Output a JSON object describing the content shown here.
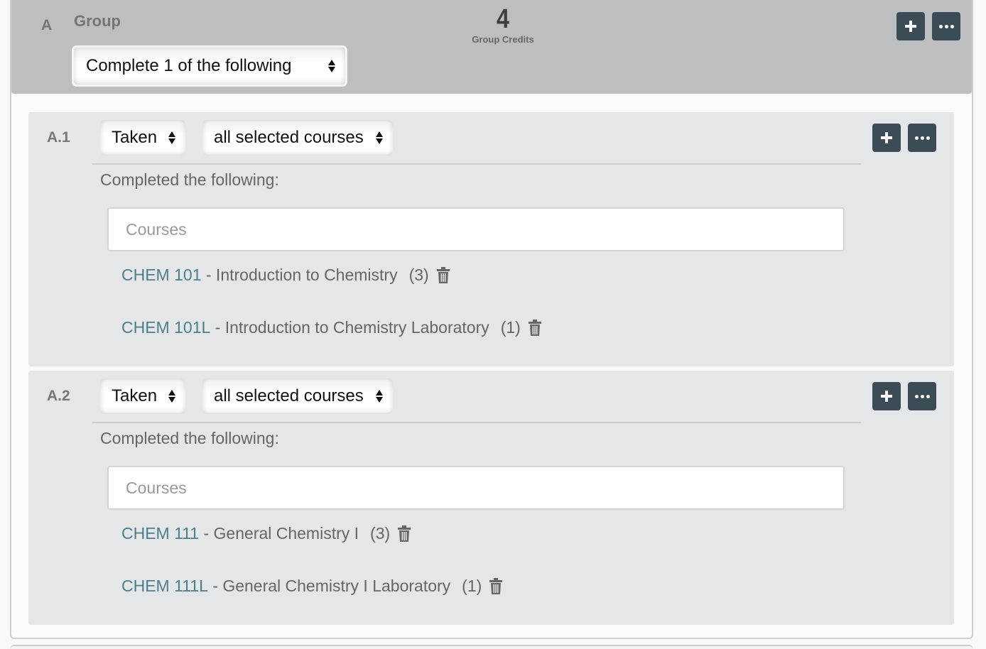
{
  "group": {
    "letter": "A",
    "title": "Group",
    "requirement_select": "Complete 1 of the following",
    "credits_value": "4",
    "credits_label": "Group Credits"
  },
  "rules": [
    {
      "label": "A.1",
      "status_select": "Taken",
      "scope_select": "all selected courses",
      "completed_label": "Completed the following:",
      "courses_placeholder": "Courses",
      "courses": [
        {
          "code": "CHEM 101",
          "title": " - Introduction to Chemistry",
          "credits": "(3)"
        },
        {
          "code": "CHEM 101L",
          "title": " - Introduction to Chemistry Laboratory",
          "credits": "(1)"
        }
      ]
    },
    {
      "label": "A.2",
      "status_select": "Taken",
      "scope_select": "all selected courses",
      "completed_label": "Completed the following:",
      "courses_placeholder": "Courses",
      "courses": [
        {
          "code": "CHEM 111",
          "title": " - General Chemistry I",
          "credits": "(3)"
        },
        {
          "code": "CHEM 111L",
          "title": " - General Chemistry I Laboratory",
          "credits": "(1)"
        }
      ]
    }
  ],
  "icons": {
    "add": "plus-icon",
    "more": "ellipsis-icon",
    "remove": "trash-icon",
    "select": "sort-arrows-icon"
  },
  "colors": {
    "button_bg": "#3b4c57",
    "course_link": "#4b7f8c",
    "group_header_bg": "#bdbebf",
    "rule_bg": "#e5e6e7"
  }
}
